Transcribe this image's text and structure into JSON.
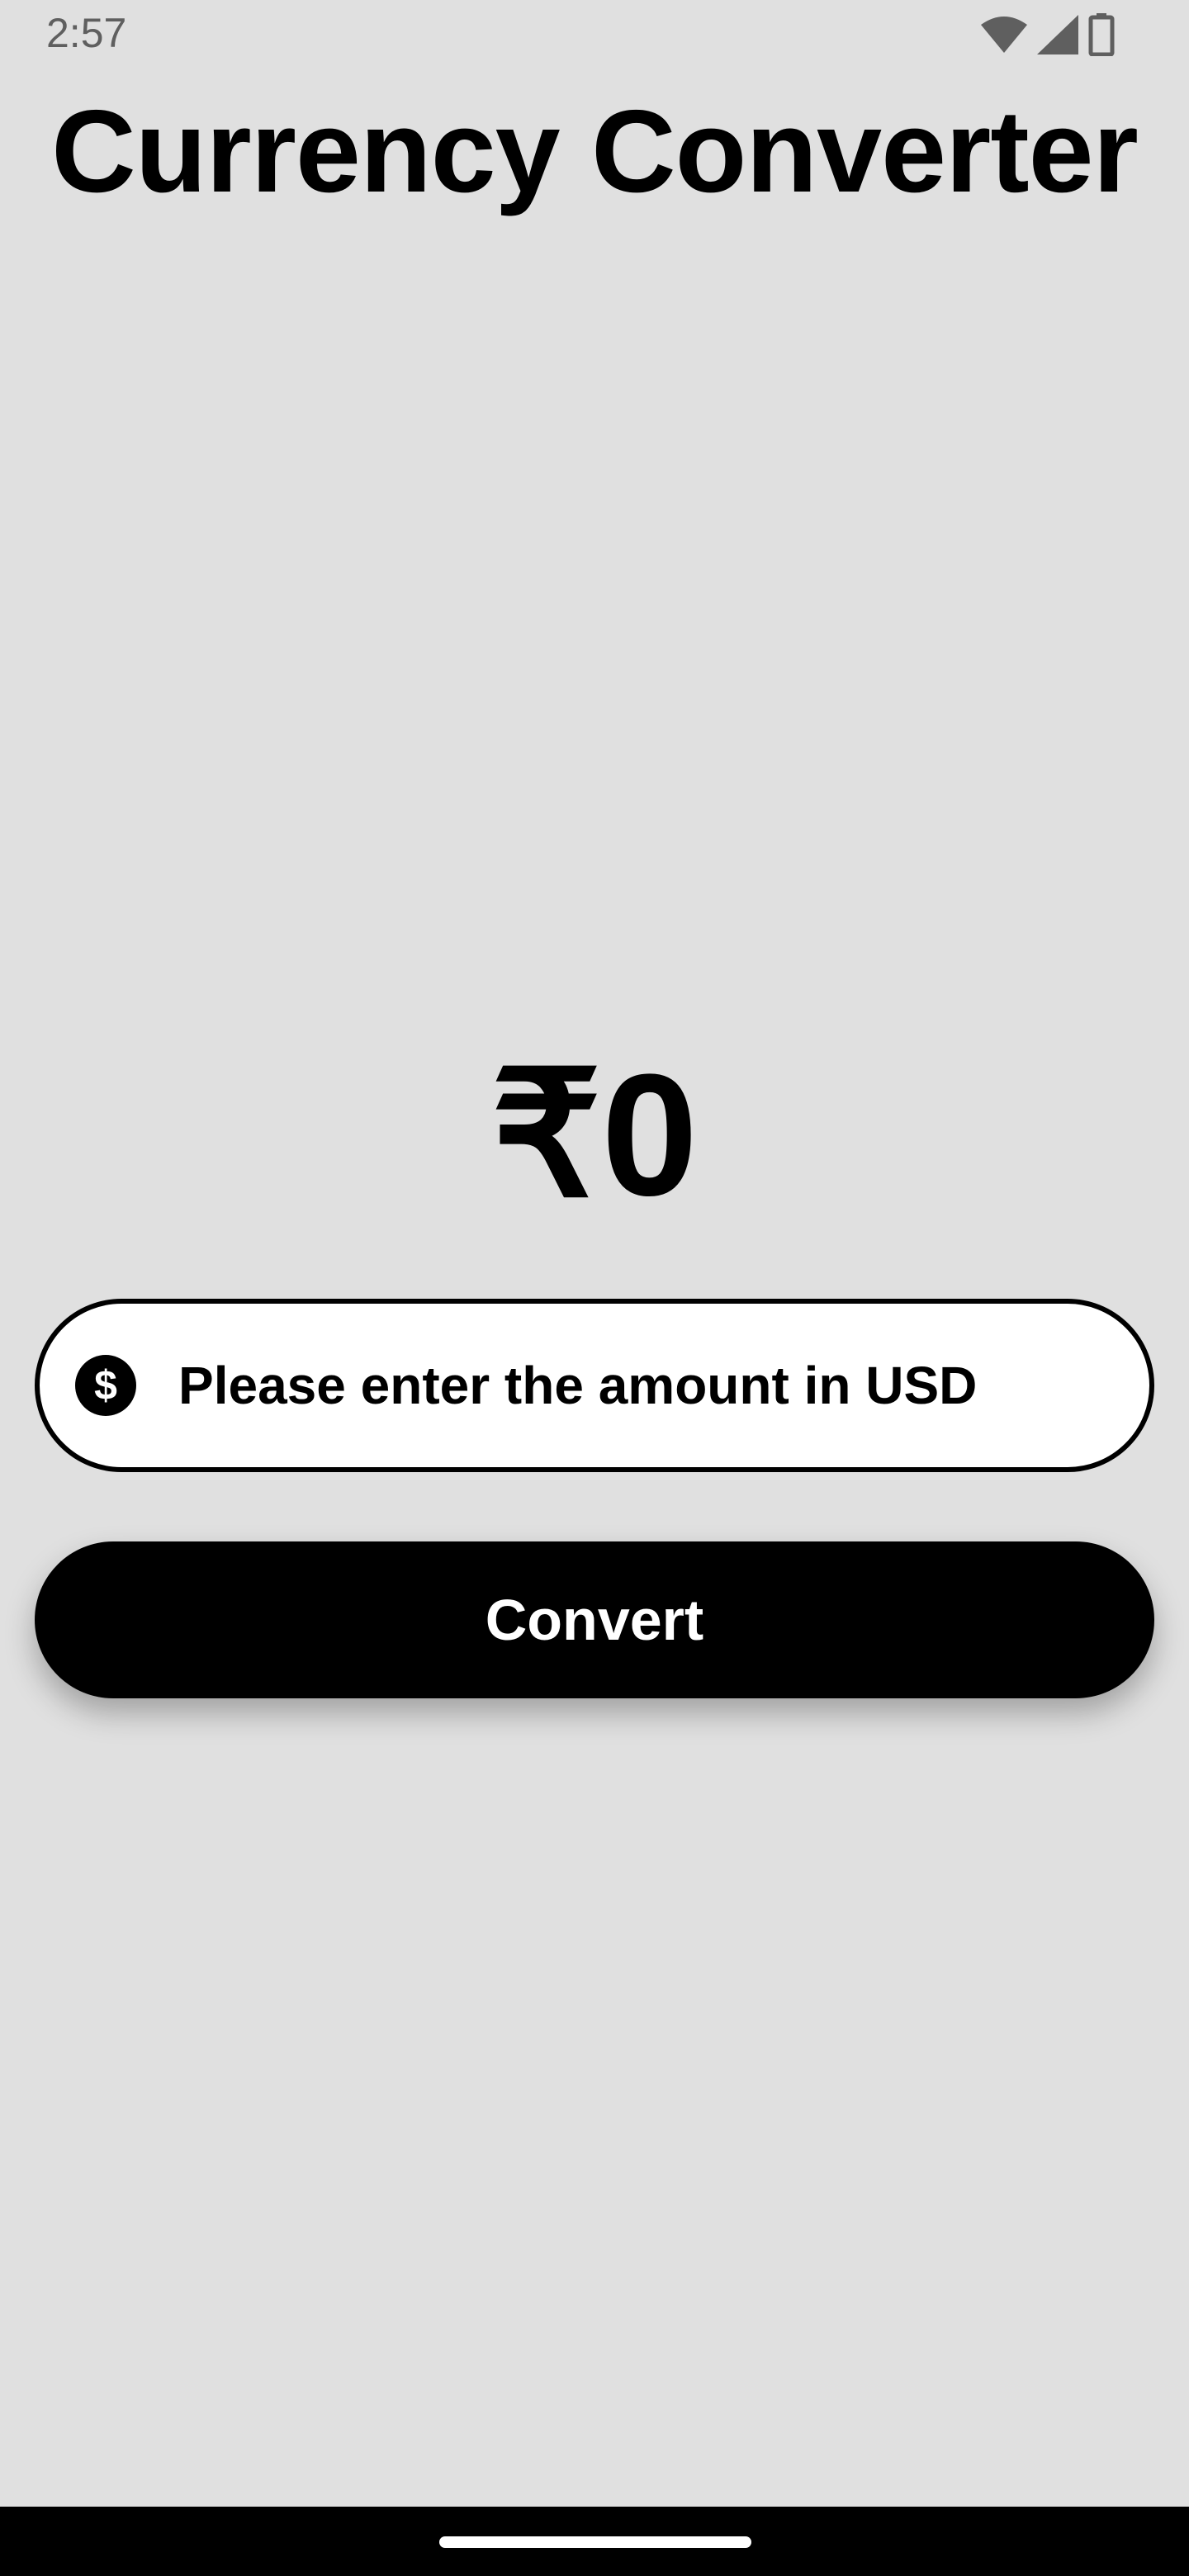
{
  "status_bar": {
    "time": "2:57",
    "icons": [
      "wifi-icon",
      "cellular-signal-icon",
      "battery-icon"
    ]
  },
  "app": {
    "title": "Currency Converter"
  },
  "result": {
    "value": "₹0"
  },
  "amount_input": {
    "value": "",
    "placeholder": "Please enter the amount in USD",
    "prefix_icon": "dollar-circle-icon"
  },
  "actions": {
    "convert_label": "Convert"
  },
  "colors": {
    "background": "#e0e0e0",
    "primary": "#000000",
    "on_primary": "#ffffff",
    "field_background": "#ffffff",
    "status_text": "#5f5f5f"
  }
}
